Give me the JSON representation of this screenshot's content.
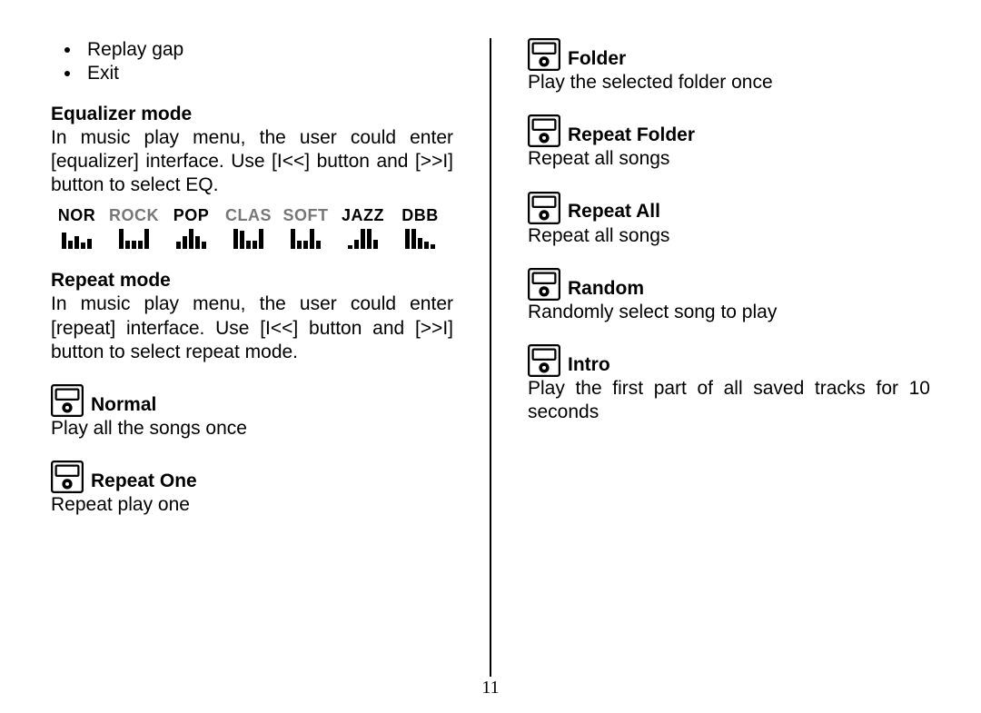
{
  "page_number": "11",
  "left": {
    "bullets": [
      "Replay gap",
      "Exit"
    ],
    "eq_title": "Equalizer mode",
    "eq_text": "In music play menu, the user could enter [equalizer] interface. Use [I<<] button and [>>I] button to select EQ.",
    "eq_presets": [
      "NOR",
      "ROCK",
      "POP",
      "CLAS",
      "SOFT",
      "JAZZ",
      "DBB"
    ],
    "eq_preset_shapes": [
      [
        18,
        9,
        14,
        7,
        11
      ],
      [
        22,
        9,
        9,
        9,
        22
      ],
      [
        8,
        14,
        22,
        14,
        8
      ],
      [
        22,
        20,
        9,
        9,
        22
      ],
      [
        22,
        9,
        9,
        22,
        9
      ],
      [
        4,
        10,
        22,
        22,
        10
      ],
      [
        22,
        22,
        12,
        8,
        5
      ]
    ],
    "eq_gray_flags": [
      false,
      true,
      false,
      true,
      true,
      false,
      false
    ],
    "repeat_title": "Repeat mode",
    "repeat_text": "In music play menu, the user could enter [repeat] interface. Use [I<<] button and [>>I] button to select repeat mode.",
    "modes": [
      {
        "name": "Normal",
        "desc": "Play all the songs once"
      },
      {
        "name": "Repeat One",
        "desc": "Repeat play one"
      }
    ]
  },
  "right": {
    "modes": [
      {
        "name": "Folder",
        "desc": "Play the selected folder once"
      },
      {
        "name": "Repeat Folder",
        "desc": "Repeat all songs"
      },
      {
        "name": "Repeat All",
        "desc": "Repeat all songs"
      },
      {
        "name": "Random",
        "desc": "Randomly select song to play"
      },
      {
        "name": "Intro",
        "desc": "Play the first part of all saved tracks for 10 seconds"
      }
    ]
  }
}
